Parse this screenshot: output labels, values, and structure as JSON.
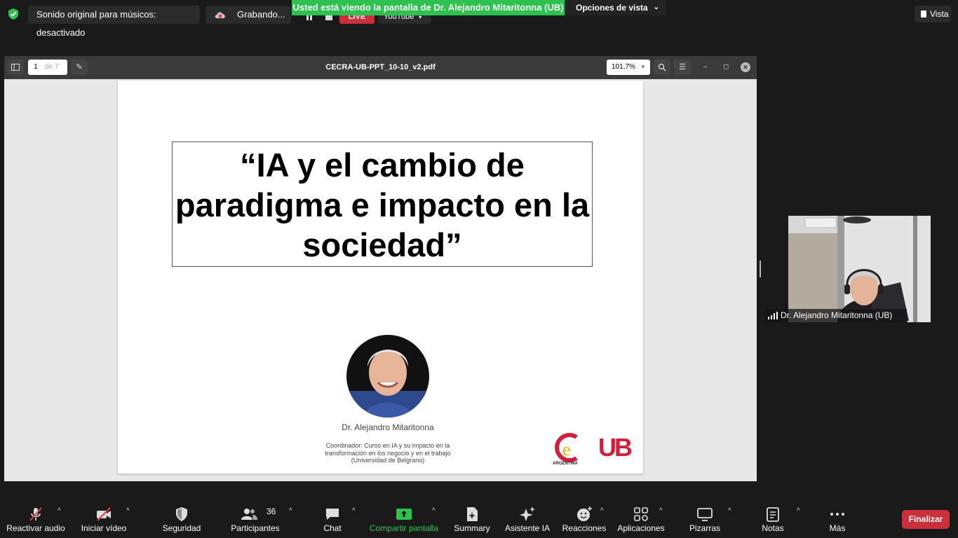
{
  "top": {
    "sound_label": "Sonido original para músicos: desactivado",
    "recording_label": "Grabando...",
    "live_label": "LIVE",
    "youtube_label": "YouTube",
    "sharing_banner": "Usted está viendo la pantalla de Dr. Alejandro Mitaritonna (UB)",
    "view_options": "Opciones de vista",
    "vista": "Vista",
    "shield_color": "#2ec14f",
    "banner_color": "#2ec14f"
  },
  "pdf": {
    "filename": "CECRA-UB-PPT_10-10_v2.pdf",
    "page": "1",
    "page_of": "de 7",
    "zoom": "101,7%",
    "slide": {
      "title": "“IA y el cambio de paradigma e impacto en la sociedad”",
      "speaker_name": "Dr. Alejandro Mitaritonna",
      "speaker_role": "Coordinador: Curso en IA y su impacto en la transformación en los negocio y en el trabajo (Universidad de Belgrano)",
      "logo_ce_caption": "ARGENTINA",
      "logo_ub": "UB",
      "ub_color": "#d01f3c"
    }
  },
  "video": {
    "participant_name": "Dr. Alejandro Mitaritonna (UB)"
  },
  "toolbar": {
    "audio": "Reactivar audio",
    "video": "Iniciar vídeo",
    "security": "Seguridad",
    "participants": "Participantes",
    "participants_count": "36",
    "chat": "Chat",
    "share": "Compartir pantalla",
    "summary": "Summary",
    "ai": "Asistente IA",
    "reactions": "Reacciones",
    "apps": "Aplicaciones",
    "whiteboards": "Pizarras",
    "notes": "Notas",
    "more": "Más",
    "end": "Finalizar",
    "end_color": "#c9303a",
    "share_color": "#2ec14f"
  }
}
